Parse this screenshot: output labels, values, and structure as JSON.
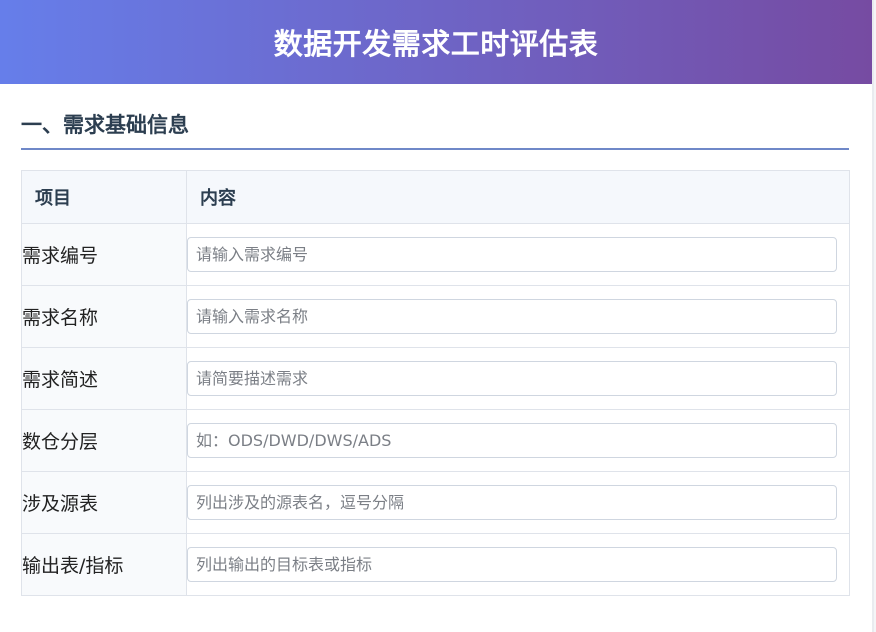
{
  "header": {
    "title": "数据开发需求工时评估表"
  },
  "section": {
    "title": "一、需求基础信息"
  },
  "table": {
    "columns": [
      "项目",
      "内容"
    ],
    "rows": [
      {
        "label": "需求编号",
        "placeholder": "请输入需求编号",
        "value": ""
      },
      {
        "label": "需求名称",
        "placeholder": "请输入需求名称",
        "value": ""
      },
      {
        "label": "需求简述",
        "placeholder": "请简要描述需求",
        "value": ""
      },
      {
        "label": "数仓分层",
        "placeholder": "如：ODS/DWD/DWS/ADS",
        "value": ""
      },
      {
        "label": "涉及源表",
        "placeholder": "列出涉及的源表名，逗号分隔",
        "value": ""
      },
      {
        "label": "输出表/指标",
        "placeholder": "列出输出的目标表或指标",
        "value": ""
      }
    ]
  },
  "colors": {
    "header_gradient_start": "#667eea",
    "header_gradient_end": "#764ba2",
    "section_underline": "#6f88c8"
  }
}
